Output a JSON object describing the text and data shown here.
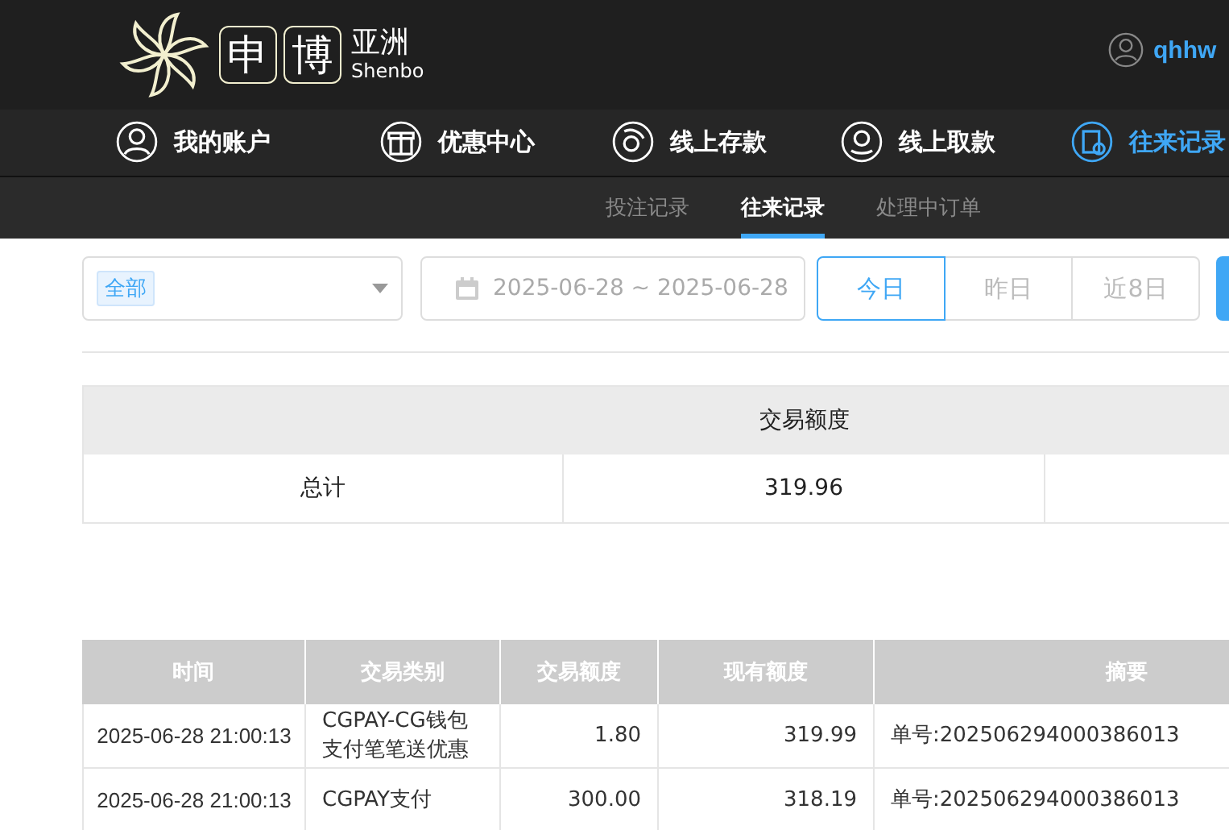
{
  "logo": {
    "box_chars": [
      "申",
      "博"
    ],
    "name_cn": "亚洲",
    "name_en": "Shenbo"
  },
  "user": {
    "name": "qhhw"
  },
  "nav": [
    {
      "label": "我的账户",
      "selected": false
    },
    {
      "label": "优惠中心",
      "selected": false
    },
    {
      "label": "线上存款",
      "selected": false
    },
    {
      "label": "线上取款",
      "selected": false
    },
    {
      "label": "往来记录",
      "selected": true
    }
  ],
  "subtabs": [
    {
      "label": "投注记录",
      "selected": false
    },
    {
      "label": "往来记录",
      "selected": true
    },
    {
      "label": "处理中订单",
      "selected": false
    }
  ],
  "filter": {
    "type_tag": "全部",
    "date_range": "2025-06-28 ~ 2025-06-28",
    "ranges": [
      {
        "label": "今日",
        "selected": true
      },
      {
        "label": "昨日",
        "selected": false
      },
      {
        "label": "近8日",
        "selected": false
      }
    ]
  },
  "summary": {
    "header": "交易额度",
    "label": "总计",
    "value": "319.96"
  },
  "table": {
    "columns": [
      "时间",
      "交易类别",
      "交易额度",
      "现有额度",
      "摘要"
    ],
    "rows": [
      [
        "2025-06-28 21:00:13",
        "CGPAY-CG钱包支付笔笔送优惠",
        "1.80",
        "319.99",
        "单号:202506294000386013"
      ],
      [
        "2025-06-28 21:00:13",
        "CGPAY支付",
        "300.00",
        "318.19",
        "单号:202506294000386013"
      ]
    ]
  }
}
